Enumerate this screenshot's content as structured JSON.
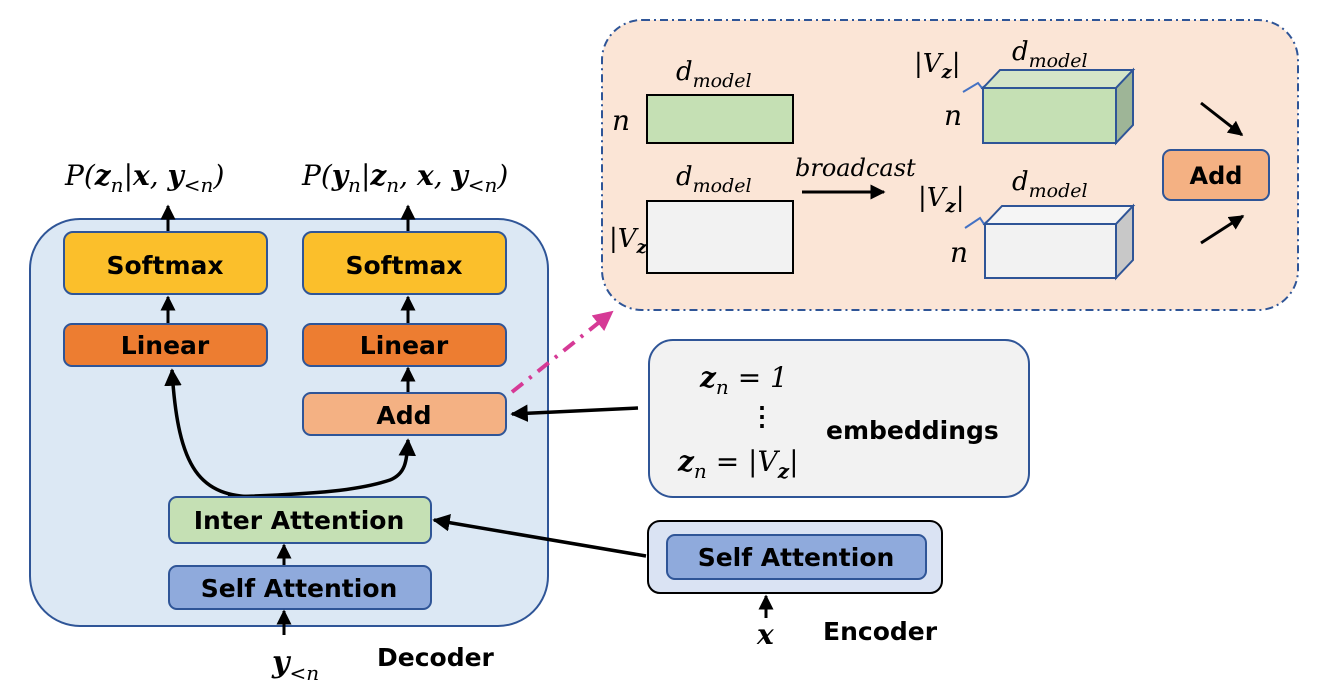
{
  "decoder": {
    "caption": "Decoder",
    "input_label": {
      "main": "y",
      "sub": "<n"
    },
    "output_z_label": {
      "prefix": "P(",
      "z": "z",
      "zsub": "n",
      "rest1": "|",
      "x": "x",
      "comma": ", ",
      "y": "y",
      "ysub": "<n",
      "close": ")"
    },
    "output_y_label": {
      "prefix": "P(",
      "y": "y",
      "ysub": "n",
      "bar": "|",
      "z": "z",
      "zsub": "n",
      "comma1": ", ",
      "x": "x",
      "comma2": ", ",
      "y2": "y",
      "y2sub": "<n",
      "close": ")"
    },
    "softmax_left": "Softmax",
    "softmax_right": "Softmax",
    "linear_left": "Linear",
    "linear_right": "Linear",
    "add": "Add",
    "inter_attention": "Inter Attention",
    "self_attention": "Self Attention"
  },
  "encoder": {
    "caption": "Encoder",
    "input_label": "x",
    "self_attention": "Self Attention"
  },
  "embeddings": {
    "label": "embeddings",
    "first": {
      "z": "z",
      "sub": "n",
      "eq": " = 1"
    },
    "ellipsis": "⋮",
    "last": {
      "z": "z",
      "sub": "n",
      "eq": " = |V",
      "vsub": "z",
      "close": "|"
    }
  },
  "inset": {
    "d_model": {
      "main": "d",
      "sub": "model"
    },
    "n": "n",
    "vz": {
      "open": "|V",
      "sub": "z",
      "close": "|"
    },
    "broadcast": "broadcast",
    "add": "Add"
  },
  "colors": {
    "decoder_bg": "#dce8f4",
    "decoder_border": "#2f5597",
    "softmax": "#fbbf2b",
    "linear": "#ed7d31",
    "add": "#f4b183",
    "inter_attention": "#c5e0b4",
    "self_attention": "#8faadc",
    "encoder_bg": "#dae3f3",
    "embeddings_bg": "#f2f2f2",
    "inset_bg": "#fbe5d6",
    "green_block": "#c5e0b4",
    "gray_block": "#f2f2f2",
    "dashed_arrow": "#d63a96",
    "brace": "#4472c4"
  }
}
